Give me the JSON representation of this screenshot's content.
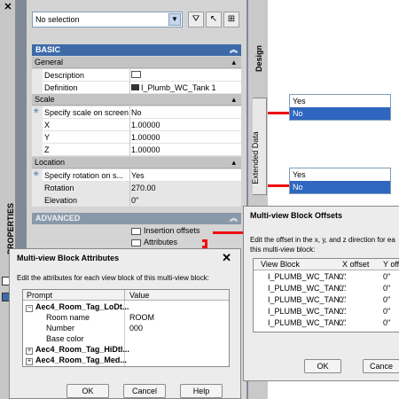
{
  "properties": {
    "side_label": "PROPERTIES",
    "close_glyph": "✕",
    "selection_value": "No selection",
    "basic_label": "BASIC",
    "advanced_label": "ADVANCED",
    "general_label": "General",
    "scale_label": "Scale",
    "location_label": "Location",
    "rows": {
      "description": {
        "label": "Description",
        "value": ""
      },
      "definition": {
        "label": "Definition",
        "value": "I_Plumb_WC_Tank 1"
      },
      "specify_scale": {
        "label": "Specify scale on screen",
        "value": "No"
      },
      "x": {
        "label": "X",
        "value": "1.00000"
      },
      "y": {
        "label": "Y",
        "value": "1.00000"
      },
      "z": {
        "label": "Z",
        "value": "1.00000"
      },
      "specify_rotation": {
        "label": "Specify rotation on s...",
        "value": "Yes"
      },
      "rotation": {
        "label": "Rotation",
        "value": "270.00"
      },
      "elevation": {
        "label": "Elevation",
        "value": "0\""
      },
      "insertion_offsets": {
        "label": "Insertion offsets"
      },
      "attributes": {
        "label": "Attributes"
      }
    }
  },
  "tabs": {
    "design": "Design",
    "extended_data": "Extended Data"
  },
  "yesno1": {
    "options": [
      "Yes",
      "No"
    ],
    "selected": "No"
  },
  "yesno2": {
    "options": [
      "Yes",
      "No"
    ],
    "selected": "No"
  },
  "offsets_dialog": {
    "title": "Multi-view Block Offsets",
    "instruction": "Edit the offset in the x, y, and z direction for ea this multi-view block:",
    "columns": [
      "View Block",
      "X offset",
      "Y off"
    ],
    "rows": [
      [
        "I_PLUMB_WC_TAN...",
        "0\"",
        "0\""
      ],
      [
        "I_PLUMB_WC_TAN...",
        "0\"",
        "0\""
      ],
      [
        "I_PLUMB_WC_TAN...",
        "0\"",
        "0\""
      ],
      [
        "I_PLUMB_WC_TAN...",
        "0\"",
        "0\""
      ],
      [
        "I_PLUMB_WC_TAN...",
        "0\"",
        "0\""
      ]
    ],
    "ok": "OK",
    "cancel": "Cance"
  },
  "attributes_dialog": {
    "title": "Multi-view Block Attributes",
    "close_glyph": "✕",
    "instruction": "Edit the attributes for each view block of this multi-view block:",
    "columns": [
      "Prompt",
      "Value"
    ],
    "group1": "Aec4_Room_Tag_LoDt...",
    "group1_rows": [
      {
        "prompt": "Room name",
        "value": "ROOM"
      },
      {
        "prompt": "Number",
        "value": "000"
      },
      {
        "prompt": "Base color",
        "value": ""
      }
    ],
    "group2": "Aec4_Room_Tag_HiDtl...",
    "group3": "Aec4_Room_Tag_Med...",
    "ok": "OK",
    "cancel": "Cancel",
    "help": "Help"
  },
  "colors": {
    "basic_header": "#3e6aa8",
    "selection_highlight": "#2f66c0",
    "callout_line": "#ee1111"
  }
}
